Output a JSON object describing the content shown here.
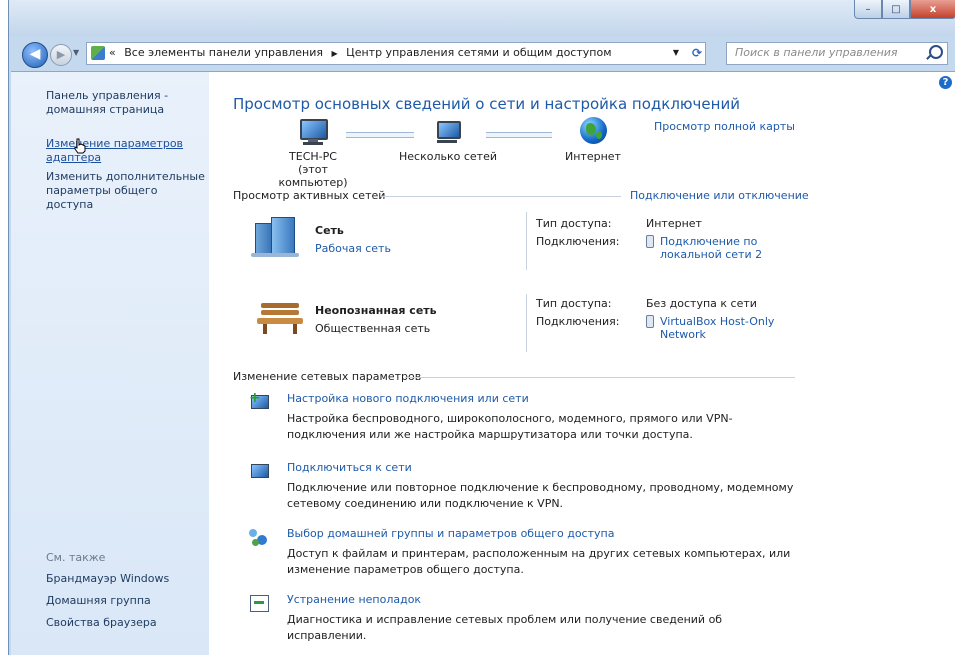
{
  "window": {
    "btn_min": "–",
    "btn_max": "□",
    "btn_close": "x"
  },
  "nav": {
    "back_glyph": "◀",
    "fwd_glyph": "▶",
    "breadcrumb_prefix": "«",
    "breadcrumb": [
      "Все элементы панели управления",
      "Центр управления сетями и общим доступом"
    ],
    "breadcrumb_sep": "▶",
    "search_placeholder": "Поиск в панели управления"
  },
  "sidebar": {
    "home": "Панель управления - домашняя страница",
    "adapter": "Изменение параметров адаптера",
    "sharing": "Изменить дополнительные параметры общего доступа",
    "see_also": "См. также",
    "links": [
      "Брандмауэр Windows",
      "Домашняя группа",
      "Свойства браузера"
    ]
  },
  "main": {
    "title": "Просмотр основных сведений о сети и настройка подключений",
    "full_map": "Просмотр полной карты",
    "map_nodes": [
      "TECH-PC\n(этот компьютер)",
      "Несколько сетей",
      "Интернет"
    ],
    "active_section": "Просмотр активных сетей",
    "connect_link": "Подключение или отключение",
    "networks": [
      {
        "name": "Сеть",
        "type": "Рабочая сеть",
        "access_label": "Тип доступа:",
        "access": "Интернет",
        "conn_label": "Подключения:",
        "conn": "Подключение по\nлокальной сети 2"
      },
      {
        "name": "Неопознанная сеть",
        "type": "Общественная сеть",
        "access_label": "Тип доступа:",
        "access": "Без доступа к сети",
        "conn_label": "Подключения:",
        "conn": "VirtualBox Host-Only\nNetwork"
      }
    ],
    "change_section": "Изменение сетевых параметров",
    "tasks": [
      {
        "title": "Настройка нового подключения или сети",
        "desc": "Настройка беспроводного, широкополосного, модемного, прямого или VPN-подключения или же настройка маршрутизатора или точки доступа."
      },
      {
        "title": "Подключиться к сети",
        "desc": "Подключение или повторное подключение к беспроводному, проводному, модемному сетевому соединению или подключение к VPN."
      },
      {
        "title": "Выбор домашней группы и параметров общего доступа",
        "desc": "Доступ к файлам и принтерам, расположенным на других сетевых компьютерах, или изменение параметров общего доступа."
      },
      {
        "title": "Устранение неполадок",
        "desc": "Диагностика и исправление сетевых проблем или получение сведений об исправлении."
      }
    ],
    "help": "?"
  }
}
